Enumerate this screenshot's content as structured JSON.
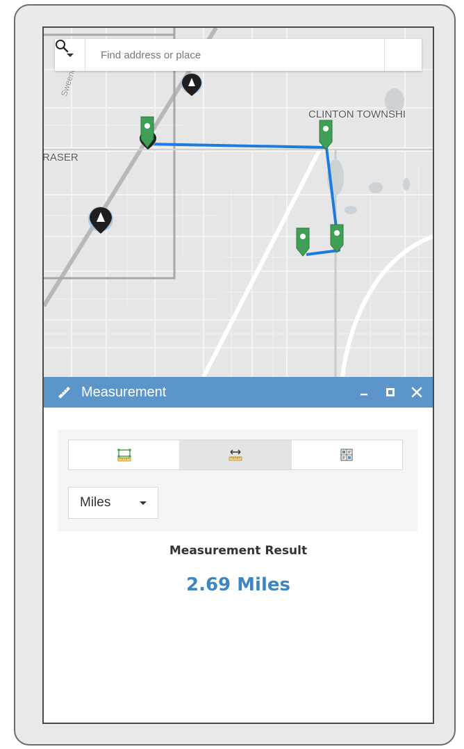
{
  "map": {
    "labels": {
      "clinton": "CLINTON TOWNSHI",
      "fraser": "RASER",
      "road": "Sweeney D"
    }
  },
  "search": {
    "placeholder": "Find address or place",
    "value": ""
  },
  "panel": {
    "title": "Measurement",
    "accent_color": "#5b95ca",
    "controls": [
      "minimize-icon",
      "maximize-icon",
      "close-icon"
    ]
  },
  "tools": {
    "items": [
      {
        "name": "area",
        "icon": "measure-area-icon",
        "active": false
      },
      {
        "name": "distance",
        "icon": "measure-distance-icon",
        "active": true
      },
      {
        "name": "location",
        "icon": "location-coordinate-icon",
        "active": false
      }
    ]
  },
  "units": {
    "selected": "Miles"
  },
  "result": {
    "title": "Measurement Result",
    "value": "2.69 Miles",
    "color": "#3e86c1"
  }
}
